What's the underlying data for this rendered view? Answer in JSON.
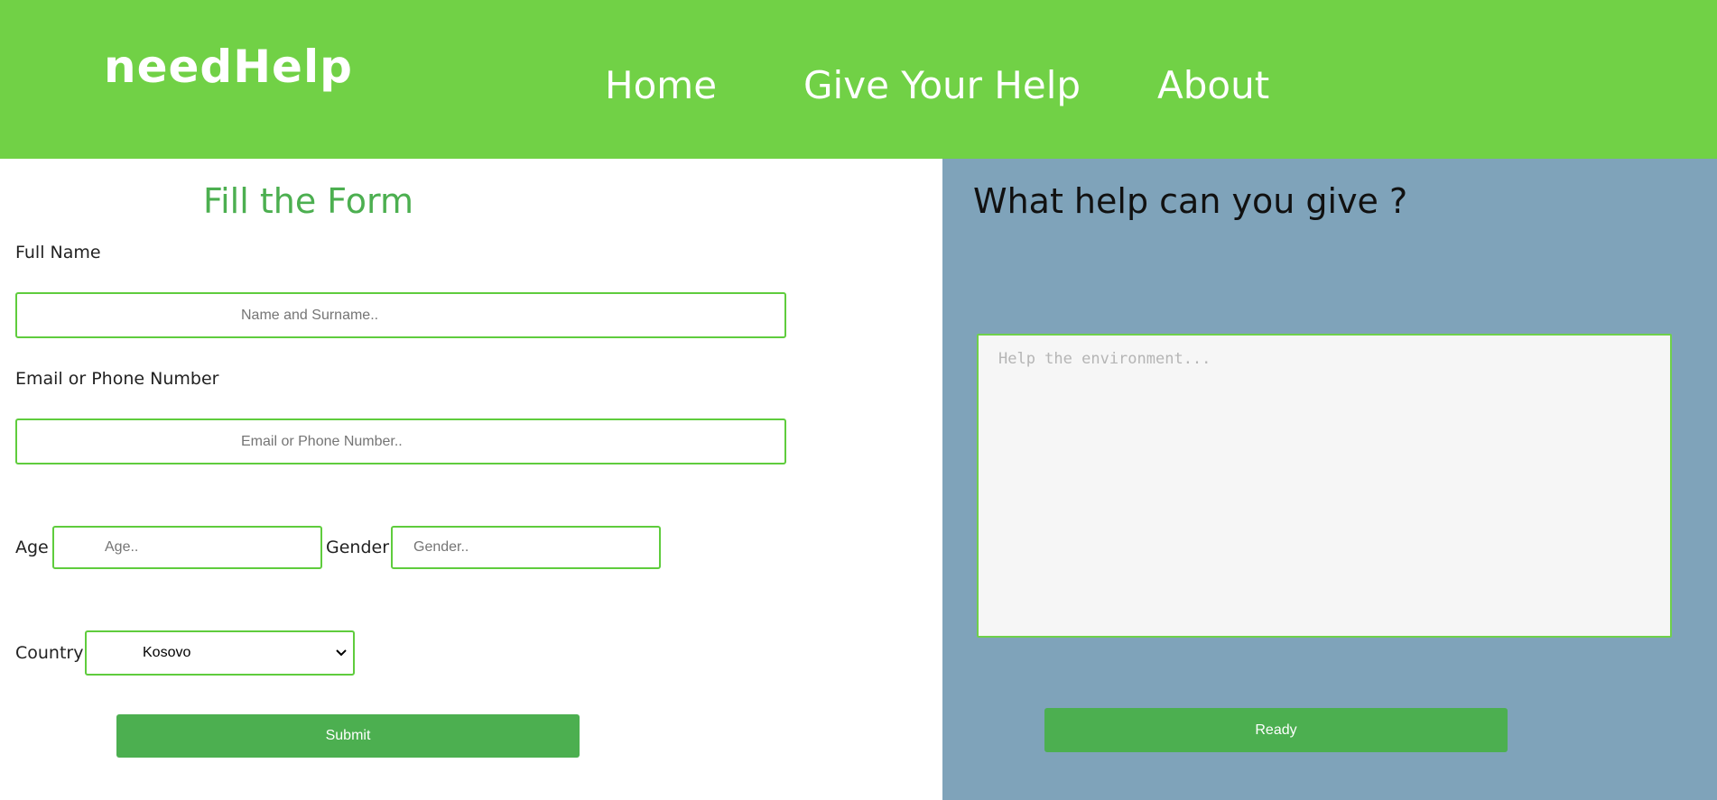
{
  "header": {
    "logo": "needHelp",
    "nav": {
      "home": "Home",
      "give_help": "Give Your Help",
      "about": "About"
    },
    "background_color": "#71d146"
  },
  "form": {
    "title": "Fill the Form",
    "full_name_label": "Full Name",
    "full_name_placeholder": "Name and Surname..",
    "email_label": "Email or Phone Number",
    "email_placeholder": "Email or Phone Number..",
    "age_label": "Age",
    "age_placeholder": "Age..",
    "gender_label": "Gender",
    "gender_placeholder": "Gender..",
    "country_label": "Country",
    "country_selected": "Kosovo",
    "submit_label": "Submit"
  },
  "help_panel": {
    "title": "What help can you give ?",
    "textarea_placeholder": "Help the environment...",
    "ready_label": "Ready",
    "background_color": "#7fa3ba"
  },
  "icons": {
    "select_chevron": "chevron-down-icon"
  },
  "colors": {
    "accent_green": "#71d146",
    "button_green": "#4caf50",
    "title_green": "#4caf50"
  }
}
